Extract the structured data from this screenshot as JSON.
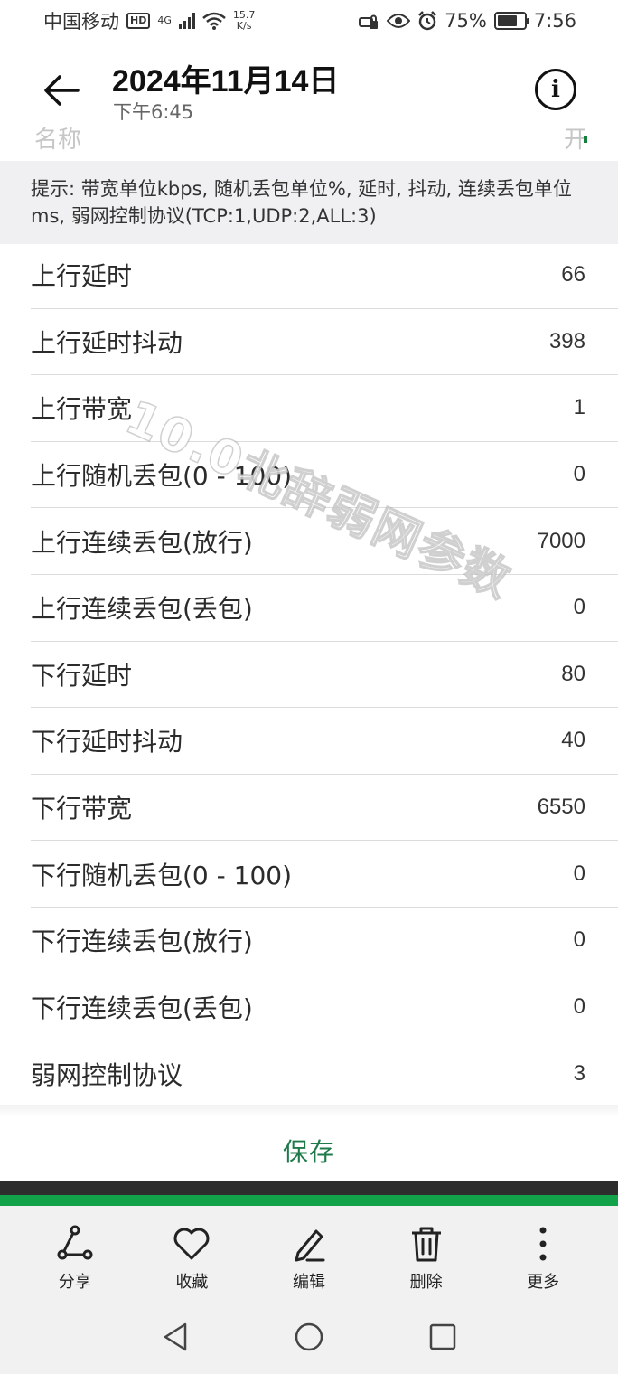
{
  "status_bar": {
    "carrier": "中国移动",
    "hd_badge": "HD",
    "network": "4G",
    "speed": "15.7",
    "speed_unit": "K/s",
    "battery": "75%",
    "battery_level": 0.75,
    "time": "7:56"
  },
  "header": {
    "title": "2024年11月14日",
    "subtitle": "下午6:45",
    "info_symbol": "i",
    "peek_label": "名称",
    "peek_value": "开"
  },
  "hint": "提示: 带宽单位kbps, 随机丢包单位%, 延时, 抖动, 连续丢包单位ms, 弱网控制协议(TCP:1,UDP:2,ALL:3)",
  "watermark": "10.0北辞弱网参数",
  "rows": [
    {
      "label": "上行延时",
      "value": "66"
    },
    {
      "label": "上行延时抖动",
      "value": "398"
    },
    {
      "label": "上行带宽",
      "value": "1"
    },
    {
      "label": "上行随机丢包(0 - 100)",
      "value": "0"
    },
    {
      "label": "上行连续丢包(放行)",
      "value": "7000"
    },
    {
      "label": "上行连续丢包(丢包)",
      "value": "0"
    },
    {
      "label": "下行延时",
      "value": "80"
    },
    {
      "label": "下行延时抖动",
      "value": "40"
    },
    {
      "label": "下行带宽",
      "value": "6550"
    },
    {
      "label": "下行随机丢包(0 - 100)",
      "value": "0"
    },
    {
      "label": "下行连续丢包(放行)",
      "value": "0"
    },
    {
      "label": "下行连续丢包(丢包)",
      "value": "0"
    },
    {
      "label": "弱网控制协议",
      "value": "3"
    }
  ],
  "save_label": "保存",
  "actions": [
    {
      "label": "分享",
      "icon": "share-icon"
    },
    {
      "label": "收藏",
      "icon": "heart-icon"
    },
    {
      "label": "编辑",
      "icon": "pencil-icon"
    },
    {
      "label": "删除",
      "icon": "trash-icon"
    },
    {
      "label": "更多",
      "icon": "more-vertical-icon"
    }
  ],
  "colors": {
    "accent_green": "#1f7a4a",
    "strip_green": "#12a34a",
    "hint_bg": "#f0f0f2"
  }
}
